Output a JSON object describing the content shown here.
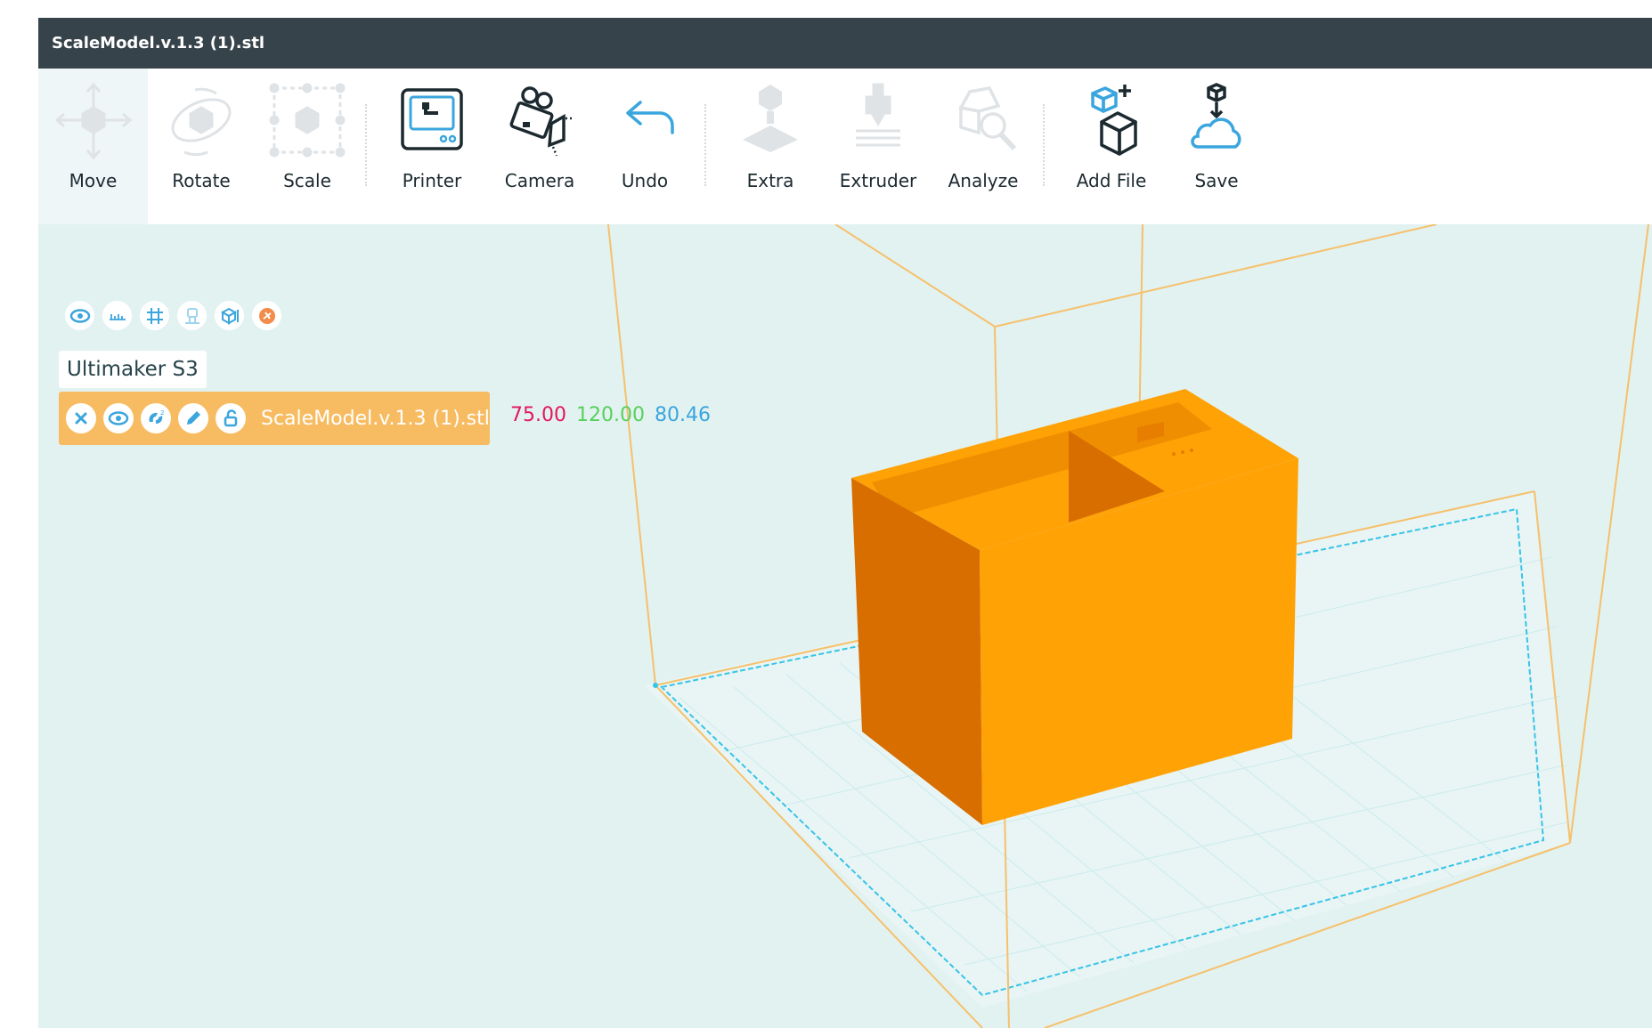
{
  "window": {
    "title": "ScaleModel.v.1.3 (1).stl"
  },
  "colors": {
    "accent": "#3aa6dd",
    "model": "#ffa206",
    "x_axis": "#e2185b",
    "y_axis": "#58d05c",
    "z_axis": "#3aa6dd",
    "titlebar": "#37434a",
    "viewport_bg": "#e2f2f1"
  },
  "toolbar": {
    "tools": [
      {
        "id": "move",
        "label": "Move",
        "icon": "move-icon",
        "active": true,
        "enabled": true
      },
      {
        "id": "rotate",
        "label": "Rotate",
        "icon": "rotate-icon",
        "enabled": false
      },
      {
        "id": "scale",
        "label": "Scale",
        "icon": "scale-icon",
        "enabled": false
      },
      {
        "id": "printer",
        "label": "Printer",
        "icon": "printer-icon",
        "enabled": true
      },
      {
        "id": "camera",
        "label": "Camera",
        "icon": "camera-icon",
        "enabled": true
      },
      {
        "id": "undo",
        "label": "Undo",
        "icon": "undo-icon",
        "enabled": true
      },
      {
        "id": "extra",
        "label": "Extra",
        "icon": "extra-icon",
        "enabled": false
      },
      {
        "id": "extruder",
        "label": "Extruder",
        "icon": "extruder-icon",
        "enabled": false
      },
      {
        "id": "analyze",
        "label": "Analyze",
        "icon": "analyze-icon",
        "enabled": false
      },
      {
        "id": "add_file",
        "label": "Add File",
        "icon": "add-file-icon",
        "enabled": true
      },
      {
        "id": "save",
        "label": "Save",
        "icon": "save-icon",
        "enabled": true
      }
    ]
  },
  "view_controls": [
    {
      "id": "visibility",
      "icon": "eye-icon"
    },
    {
      "id": "ruler",
      "icon": "ruler-icon"
    },
    {
      "id": "grid",
      "icon": "grid-icon"
    },
    {
      "id": "support",
      "icon": "support-icon"
    },
    {
      "id": "view_cube",
      "icon": "view-cube-icon"
    },
    {
      "id": "render",
      "icon": "render-mode-icon"
    }
  ],
  "printer": {
    "name": "Ultimaker S3"
  },
  "model": {
    "name": "ScaleModel.v.1.3 (1).stl",
    "actions": [
      {
        "id": "remove",
        "icon": "close-icon"
      },
      {
        "id": "visibility",
        "icon": "eye-icon"
      },
      {
        "id": "copies",
        "icon": "duplicate-icon"
      },
      {
        "id": "edit",
        "icon": "pencil-icon"
      },
      {
        "id": "lock",
        "icon": "unlock-icon"
      }
    ],
    "dimensions": {
      "x": "75.00",
      "y": "120.00",
      "z": "80.46"
    }
  }
}
